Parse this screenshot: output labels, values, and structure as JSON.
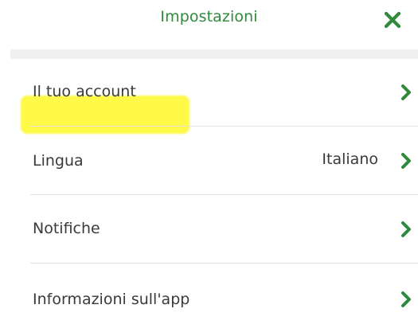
{
  "header": {
    "title": "Impostazioni",
    "close_icon": "close-x-icon"
  },
  "settings": {
    "items": [
      {
        "label": "Il tuo account",
        "value": "",
        "icon": "chevron-right-icon"
      },
      {
        "label": "Lingua",
        "value": "Italiano",
        "icon": "chevron-right-icon"
      },
      {
        "label": "Notifiche",
        "value": "",
        "icon": "chevron-right-icon"
      },
      {
        "label": "Informazioni sull'app",
        "value": "",
        "icon": "chevron-right-icon"
      }
    ]
  },
  "colors": {
    "accent": "#2f8a3b",
    "text": "#3a3a3a",
    "divider": "#e2e2e2",
    "band": "#f0f0f0",
    "highlight": "#fff828"
  }
}
